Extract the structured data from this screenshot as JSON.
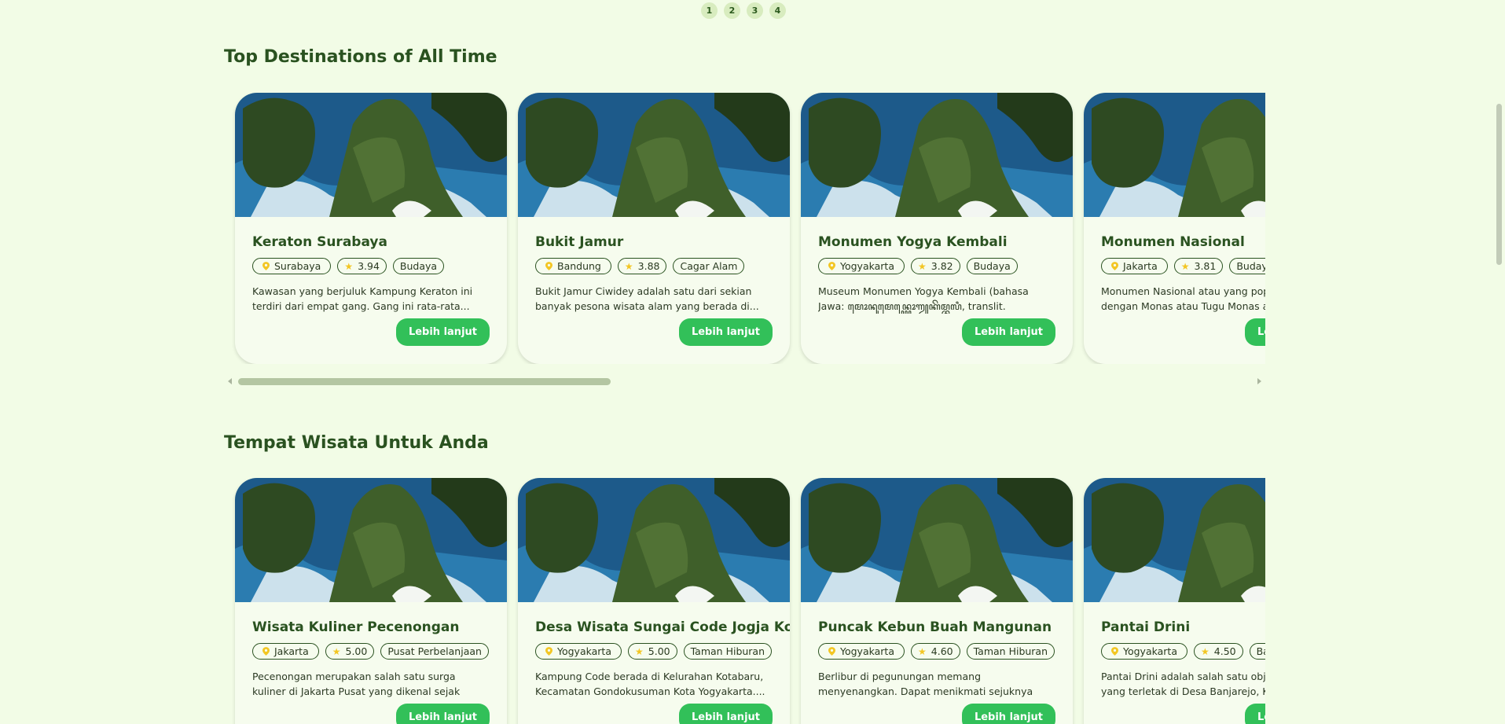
{
  "pagination": {
    "pages": [
      "1",
      "2",
      "3",
      "4"
    ]
  },
  "sections": [
    {
      "title": "Top Destinations of All Time",
      "cards": [
        {
          "title": "Keraton Surabaya",
          "city": "Surabaya",
          "rating": "3.94",
          "category": "Budaya",
          "description": "Kawasan yang berjuluk Kampung Keraton ini terdiri dari empat gang. Gang ini rata-rata...",
          "button": "Lebih lanjut"
        },
        {
          "title": "Bukit Jamur",
          "city": "Bandung",
          "rating": "3.88",
          "category": "Cagar Alam",
          "description": "Bukit Jamur Ciwidey adalah satu dari sekian banyak pesona wisata alam yang berada di...",
          "button": "Lebih lanjut"
        },
        {
          "title": "Monumen Yogya Kembali",
          "city": "Yogyakarta",
          "rating": "3.82",
          "category": "Budaya",
          "description": "Museum Monumen Yogya Kembali (bahasa Jawa: ꦩꦺꦴꦤꦸꦩꦺꦤ꧀ꦪꦺꦴꦒꦾꦏꦼꦩ꧀ꦧꦭꦶ, translit. Monumèn...",
          "button": "Lebih lanjut"
        },
        {
          "title": "Monumen Nasional",
          "city": "Jakarta",
          "rating": "3.81",
          "category": "Budaya",
          "description": "Monumen Nasional atau yang populer disingkat dengan Monas atau Tugu Monas adalah...",
          "button": "Lebih lanjut"
        }
      ]
    },
    {
      "title": "Tempat Wisata Untuk Anda",
      "cards": [
        {
          "title": "Wisata Kuliner Pecenongan",
          "city": "Jakarta",
          "rating": "5.00",
          "category": "Pusat Perbelanjaan",
          "description": "Pecenongan merupakan salah satu surga kuliner di Jakarta Pusat yang dikenal sejak zaman Jakarta...",
          "button": "Lebih lanjut"
        },
        {
          "title": "Desa Wisata Sungai Code Jogja Kota",
          "city": "Yogyakarta",
          "rating": "5.00",
          "category": "Taman Hiburan",
          "description": "Kampung Code berada di Kelurahan Kotabaru, Kecamatan Gondokusuman Kota Yogyakarta....",
          "button": "Lebih lanjut"
        },
        {
          "title": "Puncak Kebun Buah Mangunan",
          "city": "Yogyakarta",
          "rating": "4.60",
          "category": "Taman Hiburan",
          "description": "Berlibur di pegunungan memang menyenangkan. Dapat menikmati sejuknya udara serta...",
          "button": "Lebih lanjut"
        },
        {
          "title": "Pantai Drini",
          "city": "Yogyakarta",
          "rating": "4.50",
          "category": "Bahari",
          "description": "Pantai Drini adalah salah satu objek wisata yang terletak di Desa Banjarejo, Kecamatan...",
          "button": "Lebih lanjut"
        }
      ]
    }
  ],
  "icons": {
    "location": "location-pin-icon",
    "rating": "star-icon"
  },
  "colors": {
    "background": "#f2fce6",
    "accent": "#32c059",
    "heading": "#2a5220",
    "pin": "#f3c623",
    "star": "#f3c623"
  }
}
